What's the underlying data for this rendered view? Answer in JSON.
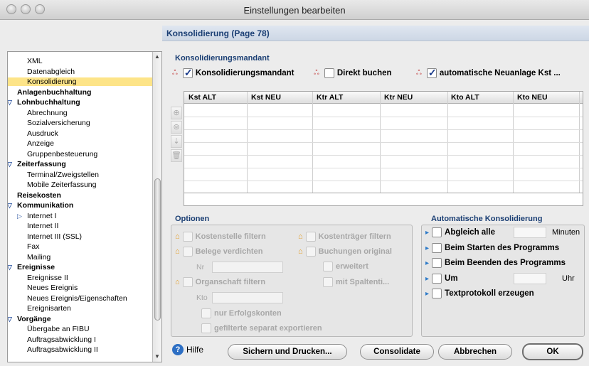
{
  "window": {
    "title": "Einstellungen bearbeiten"
  },
  "panel": {
    "header": "Konsolidierung (Page 78)"
  },
  "sidebar": {
    "items": [
      {
        "label": "XML",
        "level": 2,
        "bold": false,
        "selected": false,
        "arrow": ""
      },
      {
        "label": "Datenabgleich",
        "level": 2,
        "bold": false,
        "selected": false,
        "arrow": ""
      },
      {
        "label": "Konsolidierung",
        "level": 2,
        "bold": false,
        "selected": true,
        "arrow": ""
      },
      {
        "label": "Anlagenbuchhaltung",
        "level": 1,
        "bold": true,
        "selected": false,
        "arrow": ""
      },
      {
        "label": "Lohnbuchhaltung",
        "level": 1,
        "bold": true,
        "selected": false,
        "arrow": "▽"
      },
      {
        "label": "Abrechnung",
        "level": 2,
        "bold": false,
        "selected": false,
        "arrow": ""
      },
      {
        "label": "Sozialversicherung",
        "level": 2,
        "bold": false,
        "selected": false,
        "arrow": ""
      },
      {
        "label": "Ausdruck",
        "level": 2,
        "bold": false,
        "selected": false,
        "arrow": ""
      },
      {
        "label": "Anzeige",
        "level": 2,
        "bold": false,
        "selected": false,
        "arrow": ""
      },
      {
        "label": "Gruppenbesteuerung",
        "level": 2,
        "bold": false,
        "selected": false,
        "arrow": ""
      },
      {
        "label": "Zeiterfassung",
        "level": 1,
        "bold": true,
        "selected": false,
        "arrow": "▽"
      },
      {
        "label": "Terminal/Zweigstellen",
        "level": 2,
        "bold": false,
        "selected": false,
        "arrow": ""
      },
      {
        "label": "Mobile Zeiterfassung",
        "level": 2,
        "bold": false,
        "selected": false,
        "arrow": ""
      },
      {
        "label": "Reisekosten",
        "level": 1,
        "bold": true,
        "selected": false,
        "arrow": ""
      },
      {
        "label": "Kommunikation",
        "level": 1,
        "bold": true,
        "selected": false,
        "arrow": "▽"
      },
      {
        "label": "Internet I",
        "level": 2,
        "bold": false,
        "selected": false,
        "arrow": "▷"
      },
      {
        "label": "Internet II",
        "level": 2,
        "bold": false,
        "selected": false,
        "arrow": ""
      },
      {
        "label": "Internet III (SSL)",
        "level": 2,
        "bold": false,
        "selected": false,
        "arrow": ""
      },
      {
        "label": "Fax",
        "level": 2,
        "bold": false,
        "selected": false,
        "arrow": ""
      },
      {
        "label": "Mailing",
        "level": 2,
        "bold": false,
        "selected": false,
        "arrow": ""
      },
      {
        "label": "Ereignisse",
        "level": 1,
        "bold": true,
        "selected": false,
        "arrow": "▽"
      },
      {
        "label": "Ereignisse II",
        "level": 2,
        "bold": false,
        "selected": false,
        "arrow": ""
      },
      {
        "label": "Neues Ereignis",
        "level": 2,
        "bold": false,
        "selected": false,
        "arrow": ""
      },
      {
        "label": "Neues Ereignis/Eigenschaften",
        "level": 2,
        "bold": false,
        "selected": false,
        "arrow": ""
      },
      {
        "label": "Ereignisarten",
        "level": 2,
        "bold": false,
        "selected": false,
        "arrow": ""
      },
      {
        "label": "Vorgänge",
        "level": 1,
        "bold": true,
        "selected": false,
        "arrow": "▽"
      },
      {
        "label": "Übergabe an FIBU",
        "level": 2,
        "bold": false,
        "selected": false,
        "arrow": ""
      },
      {
        "label": "Auftragsabwicklung I",
        "level": 2,
        "bold": false,
        "selected": false,
        "arrow": ""
      },
      {
        "label": "Auftragsabwicklung II",
        "level": 2,
        "bold": false,
        "selected": false,
        "arrow": ""
      }
    ]
  },
  "konsolidierungsmandant": {
    "section_title": "Konsolidierungsmandant",
    "cb_mandant": {
      "label": "Konsolidierungsmandant",
      "checked": true
    },
    "cb_direkt": {
      "label": "Direkt buchen",
      "checked": false
    },
    "cb_neuanlage": {
      "label": "automatische Neuanlage Kst ...",
      "checked": true
    }
  },
  "table": {
    "columns": [
      "Kst ALT",
      "Kst NEU",
      "Ktr ALT",
      "Ktr NEU",
      "Kto ALT",
      "Kto NEU"
    ],
    "tools": [
      "add-row-icon",
      "duplicate-row-icon",
      "move-icon",
      "trash-icon"
    ]
  },
  "optionen": {
    "title": "Optionen",
    "kostenstelle": "Kostenstelle filtern",
    "kostentraeger": "Kostenträger filtern",
    "belege": "Belege verdichten",
    "buchungen": "Buchungen original",
    "nr_label": "Nr",
    "erweitert": "erweitert",
    "organschaft": "Organschaft filtern",
    "spaltentitel": "mit Spaltenti...",
    "kto_label": "Kto",
    "erfolgskonten": "nur Erfolgskonten",
    "separat": "gefilterte separat exportieren"
  },
  "auto": {
    "title": "Automatische Konsolidierung",
    "abgleich": "Abgleich alle",
    "minuten": "Minuten",
    "starten": "Beim Starten des Programms",
    "beenden": "Beim Beenden des Programms",
    "um": "Um",
    "uhr": "Uhr",
    "protokoll": "Textprotokoll erzeugen"
  },
  "buttons": {
    "help": "Hilfe",
    "sichern": "Sichern und Drucken...",
    "consolidate": "Consolidate",
    "abbrechen": "Abbrechen",
    "ok": "OK"
  }
}
